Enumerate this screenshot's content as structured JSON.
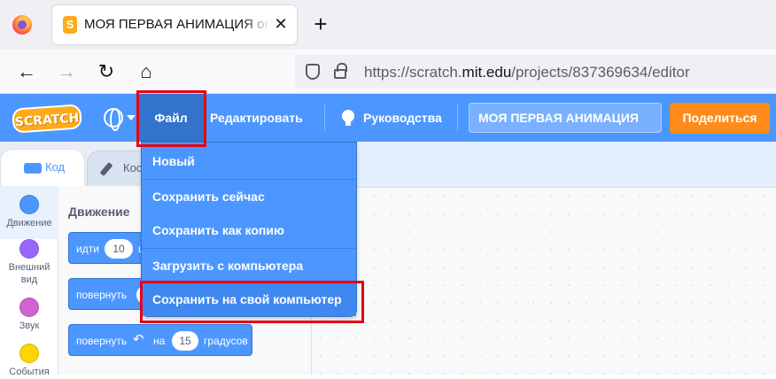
{
  "browser": {
    "tab_title": "МОЯ ПЕРВАЯ АНИМАЦИЯ on Scratch",
    "tab_favicon": "S",
    "tab_close": "✕",
    "new_tab": "+",
    "back": "←",
    "forward": "→",
    "reload": "↻",
    "home": "⌂",
    "url_prefix": "https://scratch.",
    "url_domain": "mit.edu",
    "url_path": "/projects/837369634/editor"
  },
  "menubar": {
    "logo": "SCRATCH",
    "file": "Файл",
    "edit": "Редактировать",
    "tutorials": "Руководства",
    "project_title": "МОЯ ПЕРВАЯ АНИМАЦИЯ",
    "share": "Поделиться"
  },
  "editor_tabs": {
    "code": "Код",
    "costumes": "Кос"
  },
  "categories": [
    {
      "label": "Движение",
      "color": "#4c97ff"
    },
    {
      "label": "Внешний вид",
      "color": "#9966ff"
    },
    {
      "label": "Звук",
      "color": "#cf63cf"
    },
    {
      "label": "События",
      "color": "#ffd500"
    }
  ],
  "palette": {
    "title": "Движение",
    "blocks": [
      {
        "pre": "идти",
        "value": "10",
        "post": "ш"
      },
      {
        "pre": "повернуть",
        "value": "",
        "post": ""
      },
      {
        "pre": "повернуть",
        "icon": "↶",
        "mid": "на",
        "value": "15",
        "post": "градусов"
      }
    ]
  },
  "file_menu": {
    "items": [
      "Новый",
      "Сохранить сейчас",
      "Сохранить как копию",
      "Загрузить с компьютера",
      "Сохранить на свой компьютер"
    ]
  },
  "colors": {
    "scratch_blue": "#4c97ff",
    "scratch_dark_blue": "#3373cc",
    "share_orange": "#ff8c1a",
    "highlight_red": "#e60012"
  }
}
